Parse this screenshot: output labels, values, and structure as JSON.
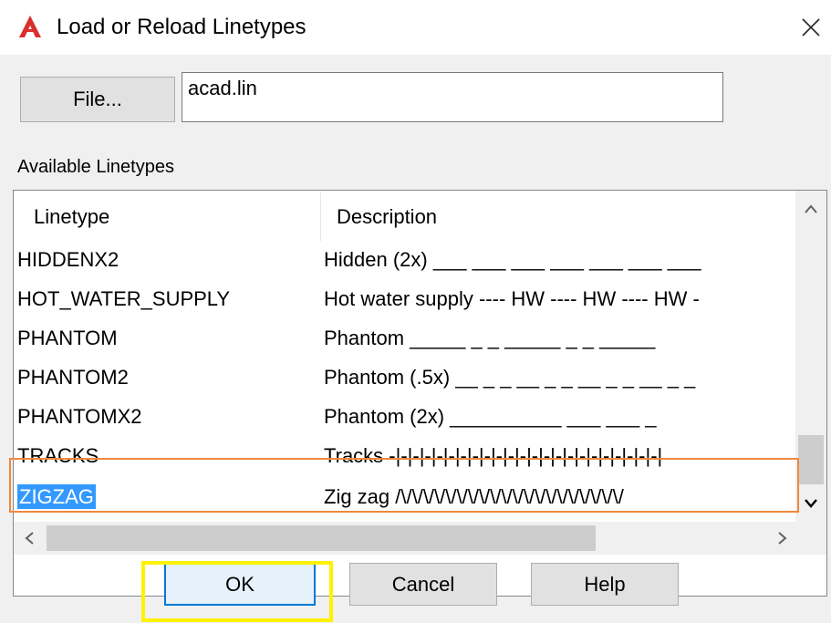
{
  "window": {
    "title": "Load or Reload Linetypes",
    "close_glyph": "✕"
  },
  "file": {
    "button_label": "File...",
    "value": "acad.lin"
  },
  "available": {
    "label": "Available Linetypes",
    "columns": {
      "linetype": "Linetype",
      "description": "Description"
    },
    "rows": [
      {
        "name": "HIDDENX2",
        "description": "Hidden (2x) ___ ___ ___ ___ ___ ___ ___"
      },
      {
        "name": "HOT_WATER_SUPPLY",
        "description": "Hot water supply ---- HW ---- HW ---- HW -"
      },
      {
        "name": "PHANTOM",
        "description": "Phantom _____  _  _  _____  _  _  _____"
      },
      {
        "name": "PHANTOM2",
        "description": "Phantom (.5x) __ _ _ __ _ _ __ _ _ __ _ _"
      },
      {
        "name": "PHANTOMX2",
        "description": "Phantom (2x) __________    ___    ___   _"
      },
      {
        "name": "TRACKS",
        "description": "Tracks -|-|-|-|-|-|-|-|-|-|-|-|-|-|-|-|-|-|-|-|-|-|-|"
      },
      {
        "name": "ZIGZAG",
        "description": "Zig zag /\\/\\/\\/\\/\\/\\/\\/\\/\\/\\/\\/\\/\\/\\/\\/\\/\\/\\/\\/\\/"
      }
    ],
    "selected": "ZIGZAG"
  },
  "buttons": {
    "ok": "OK",
    "cancel": "Cancel",
    "help": "Help"
  },
  "colors": {
    "selection": "#3399ff",
    "orange_highlight": "#f0883e",
    "yellow_highlight": "#fff200",
    "brand_red": "#d9302c"
  },
  "icons": {
    "app": "autocad-logo-icon",
    "close": "close-icon"
  }
}
